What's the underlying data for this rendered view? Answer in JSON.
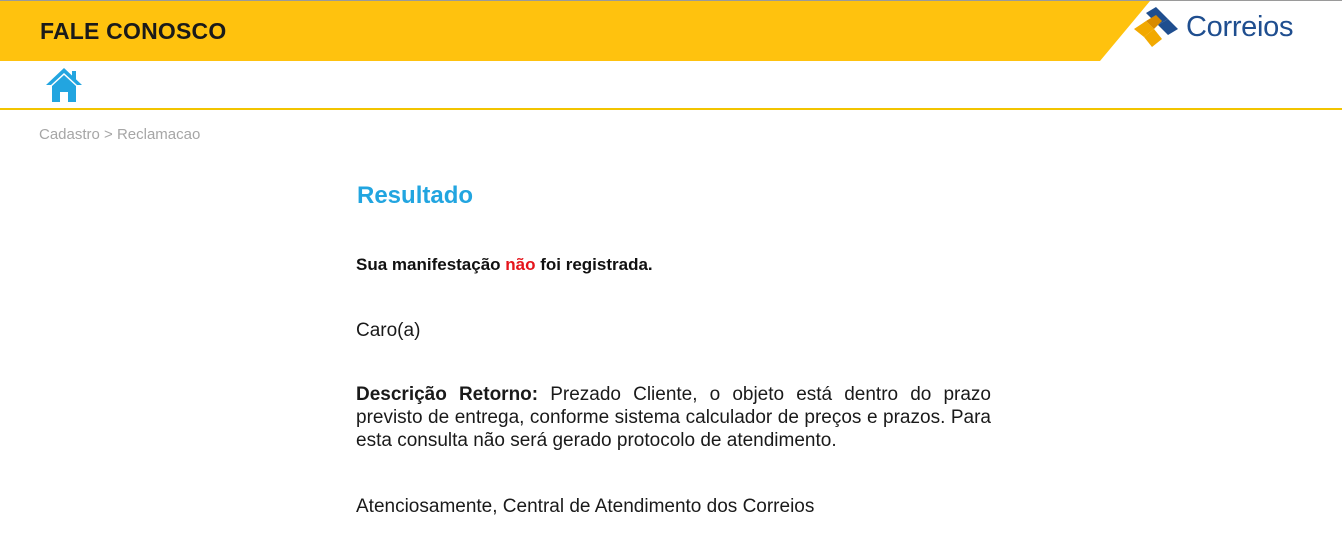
{
  "header": {
    "title": "FALE CONOSCO",
    "band_color": "#FFC20E",
    "logo": {
      "text": "Correios",
      "icon": "correios-logo-icon",
      "colors": [
        "#1F4E8F",
        "#F2A900"
      ]
    }
  },
  "nav": {
    "home_icon": "home-icon",
    "accent_color": "#22A5E0"
  },
  "breadcrumb": {
    "text": "Cadastro > Reclamacao"
  },
  "result": {
    "title": "Resultado",
    "status_prefix": "Sua manifestação ",
    "status_negation": "não",
    "status_suffix": " foi registrada.",
    "greeting": "Caro(a)",
    "description_label": "Descrição Retorno:",
    "description_text": " Prezado Cliente, o objeto está dentro do prazo previsto de entrega, conforme sistema calculador de preços e prazos. Para esta consulta não será gerado protocolo de atendimento.",
    "signoff": "Atenciosamente, Central de Atendimento dos Correios"
  }
}
